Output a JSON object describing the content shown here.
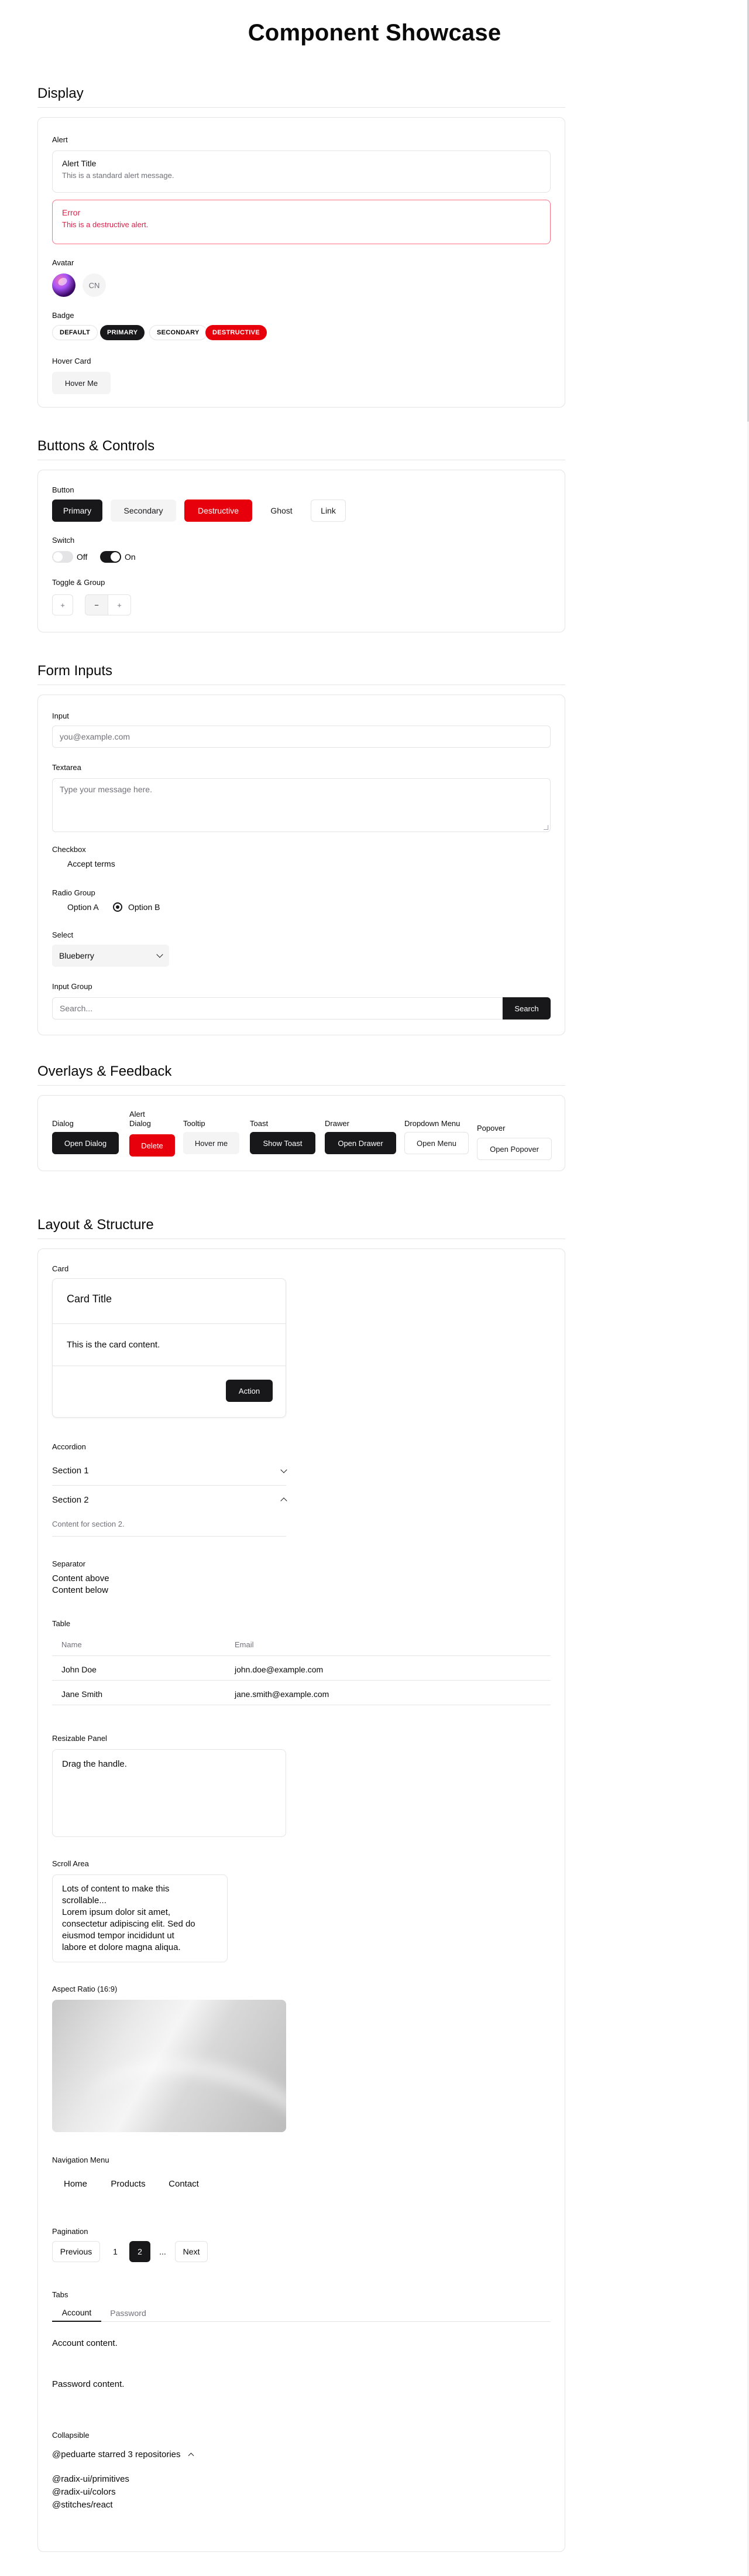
{
  "page_title": "Component Showcase",
  "sections": {
    "display": "Display",
    "buttons": "Buttons & Controls",
    "forms": "Form Inputs",
    "overlays": "Overlays & Feedback",
    "layout": "Layout & Structure"
  },
  "display": {
    "alert_label": "Alert",
    "alert_title": "Alert Title",
    "alert_desc": "This is a standard alert message.",
    "error_title": "Error",
    "error_desc": "This is a destructive alert.",
    "avatar_label": "Avatar",
    "avatar_fallback": "CN",
    "badge_label": "Badge",
    "badges": [
      "DEFAULT",
      "PRIMARY",
      "SECONDARY",
      "DESTRUCTIVE"
    ],
    "hover_card_label": "Hover Card",
    "hover_card_button": "Hover Me"
  },
  "buttons": {
    "button_label": "Button",
    "primary": "Primary",
    "secondary": "Secondary",
    "destructive": "Destructive",
    "ghost": "Ghost",
    "link": "Link",
    "switch_label": "Switch",
    "switch_off": "Off",
    "switch_on": "On",
    "toggle_label": "Toggle & Group",
    "toggles": [
      "+",
      "−",
      "+"
    ]
  },
  "forms": {
    "input_label": "Input",
    "input_placeholder": "you@example.com",
    "textarea_label": "Textarea",
    "textarea_placeholder": "Type your message here.",
    "checkbox_label": "Checkbox",
    "checkbox_text": "Accept terms",
    "radio_label": "Radio Group",
    "radio_a": "Option A",
    "radio_b": "Option B",
    "select_label": "Select",
    "select_value": "Blueberry",
    "input_group_label": "Input Group",
    "search_placeholder": "Search...",
    "search_button": "Search"
  },
  "overlays": {
    "dialog_label": "Dialog",
    "dialog_button": "Open Dialog",
    "alert_dialog_label_1": "Alert",
    "alert_dialog_label_2": "Dialog",
    "alert_dialog_button": "Delete",
    "tooltip_label": "Tooltip",
    "tooltip_button": "Hover me",
    "toast_label": "Toast",
    "toast_button": "Show Toast",
    "drawer_label": "Drawer",
    "drawer_button": "Open Drawer",
    "dropdown_label": "Dropdown Menu",
    "dropdown_button": "Open Menu",
    "popover_label": "Popover",
    "popover_button": "Open Popover"
  },
  "layout": {
    "card_label": "Card",
    "card_title": "Card Title",
    "card_content": "This is the card content.",
    "card_action": "Action",
    "accordion_label": "Accordion",
    "section1": "Section 1",
    "section2": "Section 2",
    "section2_content": "Content for section 2.",
    "separator_label": "Separator",
    "content_above": "Content above",
    "content_below": "Content below",
    "table_label": "Table",
    "table_headers": [
      "Name",
      "Email"
    ],
    "table_rows": [
      [
        "John Doe",
        "john.doe@example.com"
      ],
      [
        "Jane Smith",
        "jane.smith@example.com"
      ]
    ],
    "resizable_label": "Resizable Panel",
    "resizable_text": "Drag the handle.",
    "scroll_label": "Scroll Area",
    "scroll_lines": [
      "Lots of content to make this",
      "scrollable...",
      "Lorem ipsum dolor sit amet,",
      "consectetur adipiscing elit. Sed do",
      "eiusmod tempor incididunt ut",
      "labore et dolore magna aliqua."
    ],
    "aspect_label": "Aspect Ratio (16:9)",
    "nav_label": "Navigation Menu",
    "nav_items": [
      "Home",
      "Products",
      "Contact"
    ],
    "pagination_label": "Pagination",
    "pagination": [
      "Previous",
      "1",
      "2",
      "...",
      "Next"
    ],
    "tabs_label": "Tabs",
    "tabs": [
      "Account",
      "Password"
    ],
    "account_content": "Account content.",
    "password_content": "Password content.",
    "collapsible_label": "Collapsible",
    "collapsible_trigger": "@peduarte starred 3 repositories",
    "repos": [
      "@radix-ui/primitives",
      "@radix-ui/colors",
      "@stitches/react"
    ]
  }
}
